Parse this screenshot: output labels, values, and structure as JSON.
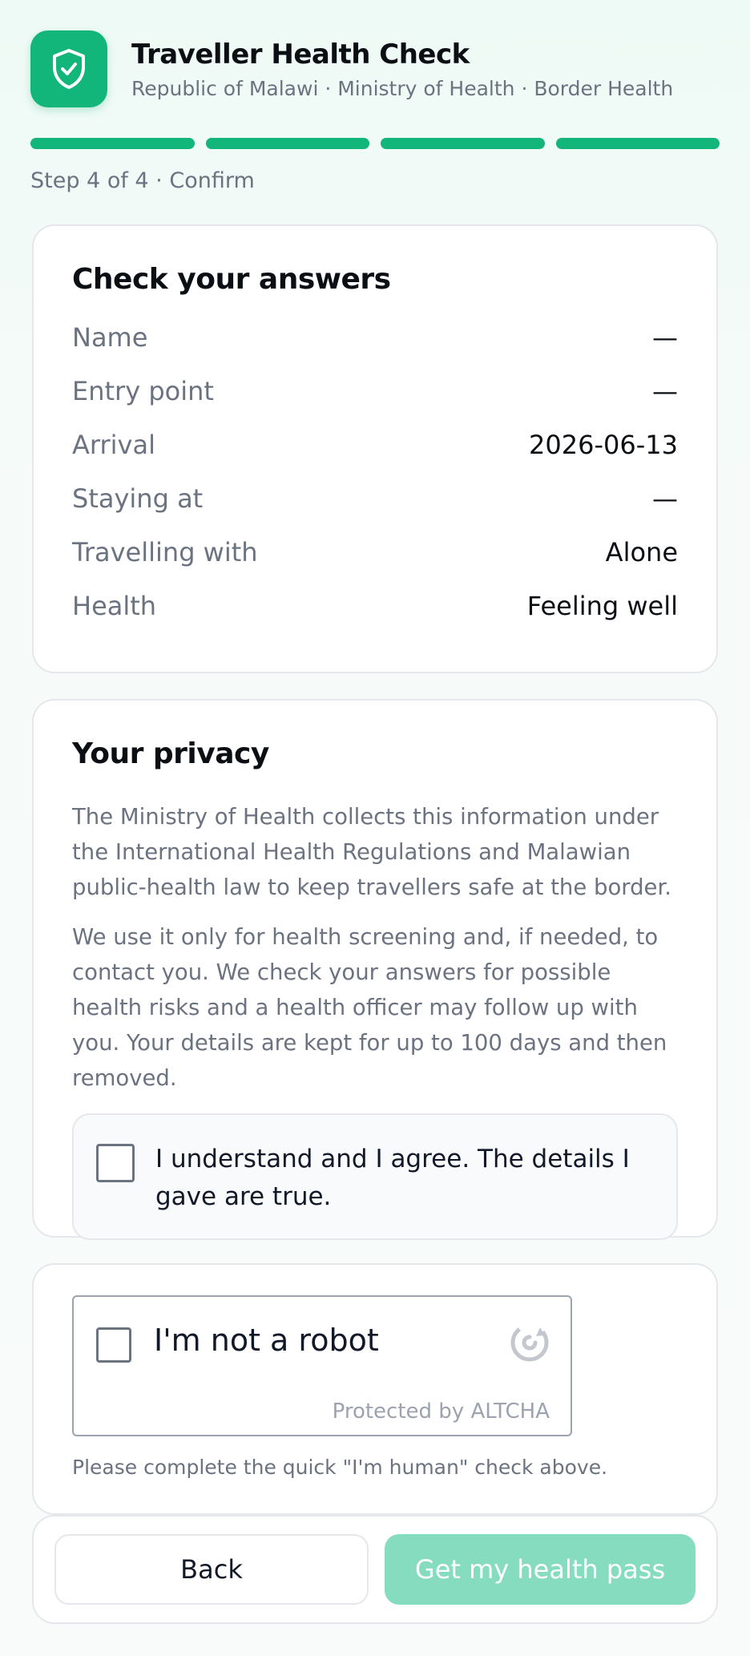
{
  "header": {
    "title": "Traveller Health Check",
    "subtitle": "Republic of Malawi · Ministry of Health · Border Health",
    "logo_icon": "shield-check-icon",
    "accent_color": "#12b57a"
  },
  "progress": {
    "current_step": 4,
    "total_steps": 4,
    "label": "Step 4 of 4 · Confirm"
  },
  "answers": {
    "title": "Check your answers",
    "rows": [
      {
        "label": "Name",
        "value": "—"
      },
      {
        "label": "Entry point",
        "value": "—"
      },
      {
        "label": "Arrival",
        "value": "2026-06-13"
      },
      {
        "label": "Staying at",
        "value": "—"
      },
      {
        "label": "Travelling with",
        "value": "Alone"
      },
      {
        "label": "Health",
        "value": "Feeling well"
      }
    ]
  },
  "privacy": {
    "title": "Your privacy",
    "paragraph1": "The Ministry of Health collects this information under the International Health Regulations and Malawian public-health law to keep travellers safe at the border.",
    "paragraph2": "We use it only for health screening and, if needed, to contact you. We check your answers for possible health risks and a health officer may follow up with you. Your details are kept for up to 100 days and then removed.",
    "consent_label": "I understand and I agree. The details I gave are true.",
    "consent_checked": false
  },
  "captcha": {
    "label": "I'm not a robot",
    "brand": "Protected by ALTCHA",
    "help": "Please complete the quick \"I'm human\" check above.",
    "checked": false
  },
  "actions": {
    "back_label": "Back",
    "submit_label": "Get my health pass"
  }
}
